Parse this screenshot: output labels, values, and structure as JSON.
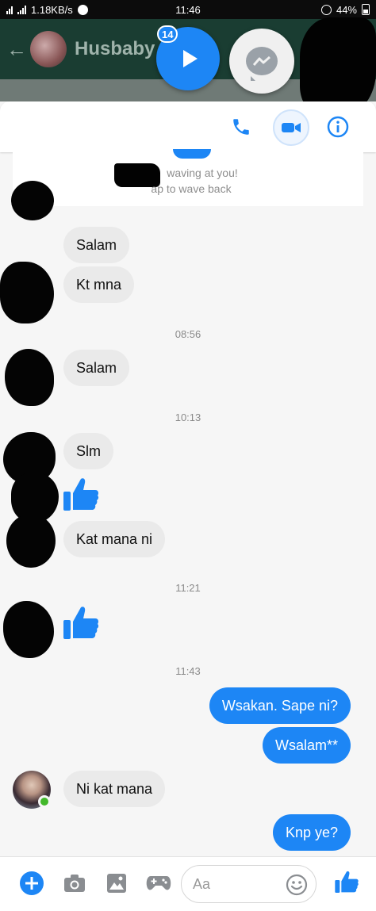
{
  "status_bar": {
    "network_speed": "1.18KB/s",
    "time": "11:46",
    "battery": "44%"
  },
  "background_header": {
    "contact_name": "Husbaby",
    "back_icon": "back-arrow-icon"
  },
  "chat_heads": {
    "video_badge_count": "14",
    "messenger_icon": "messenger-icon"
  },
  "header": {
    "call_icon": "phone-icon",
    "video_icon": "video-camera-icon",
    "info_icon": "info-icon"
  },
  "wave": {
    "line1": "waving at you!",
    "line2": "ap to wave back"
  },
  "timestamps": [
    "08:56",
    "10:13",
    "11:21",
    "11:43"
  ],
  "messages": [
    {
      "side": "in",
      "text": "Salam"
    },
    {
      "side": "in",
      "text": "Kt mna"
    },
    {
      "side": "in",
      "text": "Salam"
    },
    {
      "side": "in",
      "text": "Slm"
    },
    {
      "side": "in",
      "text": "Kat mana ni"
    },
    {
      "side": "out",
      "text": "Wsakan.  Sape ni?"
    },
    {
      "side": "out",
      "text": "Wsalam**"
    },
    {
      "side": "in",
      "text": "Ni kat mana"
    },
    {
      "side": "out",
      "text": "Knp ye?"
    }
  ],
  "composer": {
    "placeholder": "Aa",
    "icons": [
      "plus-icon",
      "camera-icon",
      "image-icon",
      "gamepad-icon",
      "emoji-icon",
      "like-icon"
    ]
  },
  "colors": {
    "accent": "#1d86f5",
    "incoming_bubble": "#eaeaea",
    "online": "#42b72a"
  }
}
